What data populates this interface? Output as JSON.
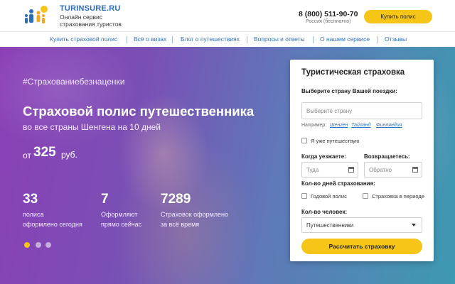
{
  "header": {
    "brand": "TURINSURE.RU",
    "tagline_line1": "Онлайн сервис",
    "tagline_line2": "страхования туристов",
    "phone": "8 (800) 511-90-70",
    "phone_note": "Россия (бесплатно)",
    "buy_label": "Купить полис"
  },
  "nav": {
    "items": [
      {
        "label": "Купить страховой полис"
      },
      {
        "label": "Всё о визах"
      },
      {
        "label": "Блог о путешествиях"
      },
      {
        "label": "Вопросы и ответы"
      },
      {
        "label": "О нашем сервисе"
      },
      {
        "label": "Отзывы"
      }
    ]
  },
  "hero": {
    "hashtag": "#Страхованиебезнаценки",
    "title": "Страховой полис путешественника",
    "subtitle": "во все страны Шенгена на 10 дней",
    "price_prefix": "от",
    "price_value": "325",
    "price_unit": "руб.",
    "stats": [
      {
        "number": "33",
        "line1": "полиса",
        "line2": "оформлено сегодня"
      },
      {
        "number": "7",
        "line1": "Оформляют",
        "line2": "прямо сейчас"
      },
      {
        "number": "7289",
        "line1": "Страховок оформлено",
        "line2": "за всё время"
      }
    ],
    "slider_active": 1,
    "slider_count": 3
  },
  "form": {
    "title": "Туристическая страховка",
    "country_label": "Выберите страну Вашей поездки:",
    "country_placeholder": "Выберите страну",
    "example_prefix": "Например:",
    "examples": [
      "Шенген",
      "Тайланд",
      "Финляндия"
    ],
    "already_traveling": "Я уже путешествую",
    "depart_label": "Когда уезжаете:",
    "depart_placeholder": "Туда",
    "return_label": "Возвращаетесь:",
    "return_placeholder": "Обратно",
    "days_label": "Кол-во дней страхования:",
    "annual_option": "Годовой полис",
    "period_option": "Страховка в периоде",
    "people_label": "Кол-во человек:",
    "people_value": "Путешественники",
    "submit_label": "Рассчитать страховку"
  },
  "colors": {
    "accent": "#f5c518",
    "brand_blue": "#2e6fbd",
    "hero_purple": "#8b3fb7",
    "hero_teal": "#3d9ab0"
  }
}
